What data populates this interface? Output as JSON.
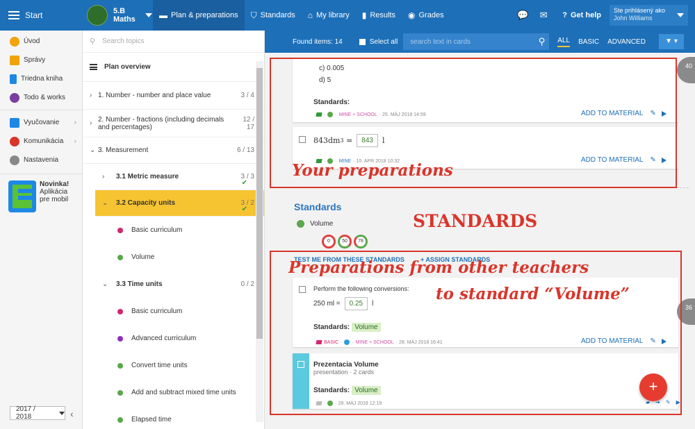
{
  "topbar": {
    "start_label": "Start",
    "class_line1": "5.B",
    "class_line2": "Maths",
    "nav": [
      {
        "label": "Plan & preparations",
        "icon": "briefcase-icon"
      },
      {
        "label": "Standards",
        "icon": "shield-icon"
      },
      {
        "label": "My library",
        "icon": "library-icon"
      },
      {
        "label": "Results",
        "icon": "bar-chart-icon"
      },
      {
        "label": "Grades",
        "icon": "grades-icon"
      }
    ],
    "help_label": "Get help",
    "user_line1": "Ste prihlásený ako",
    "user_line2": "John Williams"
  },
  "sidebar": {
    "items": [
      {
        "label": "Úvod",
        "color": "#f0a30a"
      },
      {
        "label": "Správy",
        "color": "#f0a30a"
      },
      {
        "label": "Triedna kniha",
        "color": "#1e88e5"
      },
      {
        "label": "Todo & works",
        "color": "#7b3fa0"
      },
      {
        "label": "Vyučovanie",
        "color": "#1e88e5"
      },
      {
        "label": "Komunikácia",
        "color": "#d9352b"
      },
      {
        "label": "Nastavenia",
        "color": "#888888"
      }
    ],
    "promo_title": "Novinka!",
    "promo_l2": "Aplikácia",
    "promo_l3": "pre mobil",
    "year": "2017 / 2018"
  },
  "topics": {
    "search_placeholder": "Search topics",
    "plan_overview": "Plan overview",
    "t1": {
      "label": "1. Number - number and place value",
      "count": "3 / 4"
    },
    "t2": {
      "label": "2. Number - fractions (including decimals and percentages)",
      "count": "12 / 17"
    },
    "t3": {
      "label": "3. Measurement",
      "count": "6 / 13"
    },
    "t31": {
      "label": "3.1 Metric measure",
      "count": "3 / 3"
    },
    "t32": {
      "label": "3.2 Capacity units",
      "count": "3 / 2"
    },
    "t32_leaf1": "Basic curriculum",
    "t32_leaf2": "Volume",
    "t33": {
      "label": "3.3 Time units",
      "count": "0 / 2"
    },
    "t33_leaf1": "Basic curriculum",
    "t33_leaf2": "Advanced curriculum",
    "t33_leaf3": "Convert time units",
    "t33_leaf4": "Add and subtract mixed time units",
    "t33_leaf5": "Elapsed time"
  },
  "filter": {
    "found": "Found items: 14",
    "select_all": "Select all",
    "search_placeholder": "search text in cards",
    "tab_all": "ALL",
    "tab_basic": "BASIC",
    "tab_advanced": "ADVANCED"
  },
  "card1": {
    "opt_c": "c)  0.005",
    "opt_d": "d)  5",
    "standards_label": "Standards:",
    "meta_src": "MINE + SCHOOL",
    "meta_date": "25. MÁJ 2018 14:59",
    "add": "ADD TO MATERIAL"
  },
  "card2": {
    "expr": "843dm",
    "exp": "3",
    "eq": "=",
    "answer": "843",
    "unit": "l",
    "meta_src": "MINE",
    "meta_date": "10. APR 2018 10:32",
    "add": "ADD TO MATERIAL"
  },
  "standards_section": {
    "title": "Standards",
    "item": "Volume",
    "rings": [
      "0",
      "50",
      "78"
    ],
    "test_me": "TEST ME FROM THESE STANDARDS",
    "assign": "+ ASSIGN STANDARDS"
  },
  "card3": {
    "question": "Perform the following conversions:",
    "left": "250 ml =",
    "answer": "0.25",
    "unit": "l",
    "standards_label": "Standards:",
    "tag": "Volume",
    "level": "BASIC",
    "meta_src": "MINE + SCHOOL",
    "meta_date": "28. MÁJ 2018 16:41",
    "add": "ADD TO MATERIAL"
  },
  "card4": {
    "title": "Prezentacia Volume",
    "subtitle": "presentation · 2 cards",
    "standards_label": "Standards:",
    "tag": "Volume",
    "meta_date": "28. MÁJ 2018 12:19"
  },
  "badges": {
    "top": "40",
    "mid": "36"
  },
  "annotations": {
    "your_prep": "Your preparations",
    "standards": "STANDARDS",
    "other1": "Preparations from other teachers",
    "other2": "to standard “Volume”"
  },
  "colors": {
    "brand": "#1d6fb8",
    "highlight": "#f6c431",
    "annotation": "#d9352b"
  }
}
